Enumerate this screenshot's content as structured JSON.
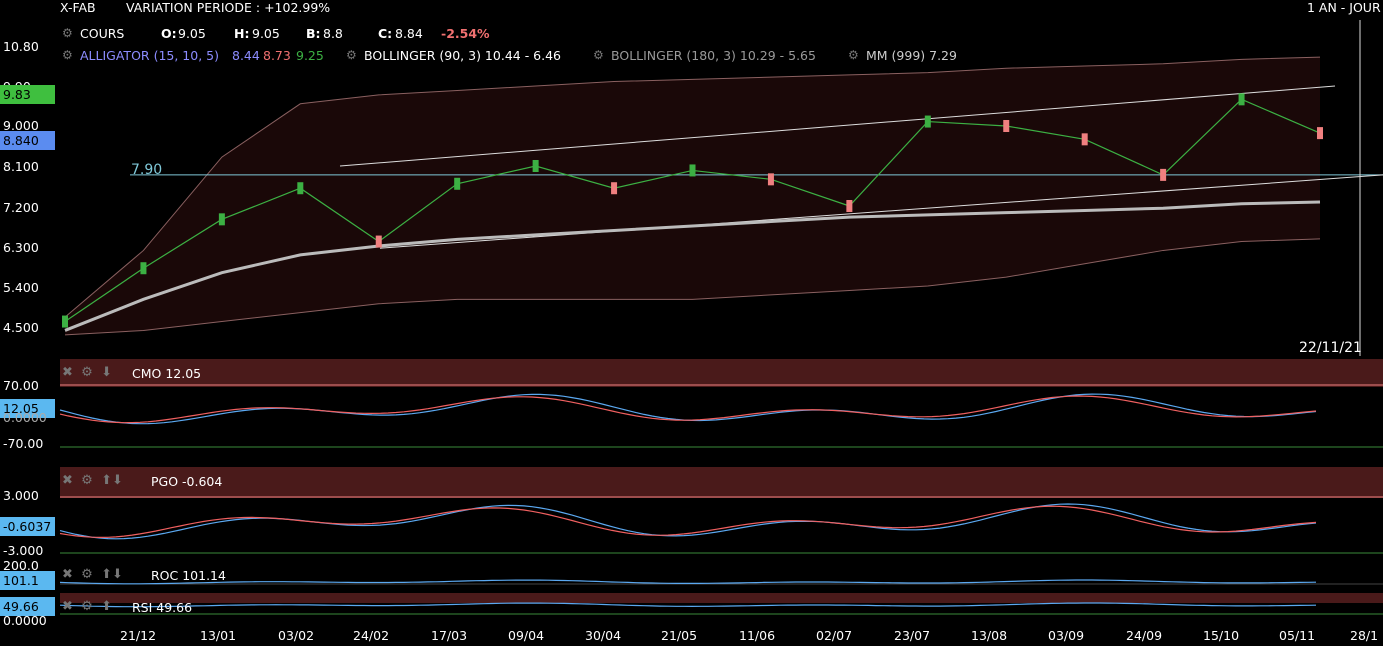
{
  "header": {
    "symbol": "X-FAB",
    "variation_label": "VARIATION PERIODE : +102.99%",
    "period": "1 AN - JOUR",
    "cours_label": "COURS",
    "open_label": "O:",
    "open_value": "9.05",
    "high_label": "H:",
    "high_value": "9.05",
    "low_label": "B:",
    "low_value": "8.8",
    "close_label": "C:",
    "close_value": "8.84",
    "change": "-2.54%",
    "alligator_label": "ALLIGATOR (15, 10, 5)",
    "alligator_v1": "8.44",
    "alligator_v2": "8.73",
    "alligator_v3": "9.25",
    "bollinger1_label": "BOLLINGER (90, 3) 10.44 - 6.46",
    "bollinger2_label": "BOLLINGER (180, 3) 10.29 - 5.65",
    "mm_label": "MM (999) 7.29"
  },
  "main_chart": {
    "y_ticks": [
      "10.80",
      "9.90",
      "9.000",
      "8.100",
      "7.200",
      "6.300",
      "5.400",
      "4.500"
    ],
    "price_badges": [
      "9.83",
      "8.840"
    ],
    "hline_label": "7.90",
    "cursor_date": "22/11/21"
  },
  "indicators": {
    "cmo": {
      "label": "CMO 12.05",
      "badge": "12.05",
      "ticks": [
        "70.00",
        "0.0000",
        "-70.00"
      ]
    },
    "pgo": {
      "label": "PGO -0.604",
      "badge": "-0.6037",
      "ticks": [
        "3.000",
        "-3.000"
      ]
    },
    "roc": {
      "label": "ROC 101.14",
      "badge": "101.1",
      "ticks": [
        "200.0"
      ]
    },
    "rsi": {
      "label": "RSI 49.66",
      "badge": "49.66",
      "ticks": [
        "0.0000"
      ]
    }
  },
  "x_axis": [
    "21/12",
    "13/01",
    "03/02",
    "24/02",
    "17/03",
    "09/04",
    "30/04",
    "21/05",
    "11/06",
    "02/07",
    "23/07",
    "13/08",
    "03/09",
    "24/09",
    "15/10",
    "05/11",
    "28/1"
  ],
  "colors": {
    "up": "#3cb043",
    "down": "#f08080",
    "badge_green": "#3fbf3f",
    "badge_blue": "#5b8cf0",
    "cyan": "#7fc8d8",
    "indicator_badge": "#5bb8f0"
  },
  "chart_data": {
    "type": "line",
    "title": "X-FAB",
    "x": [
      "21/12",
      "13/01",
      "03/02",
      "24/02",
      "17/03",
      "09/04",
      "30/04",
      "21/05",
      "11/06",
      "02/07",
      "23/07",
      "13/08",
      "03/09",
      "24/09",
      "15/10",
      "05/11",
      "22/11"
    ],
    "series": [
      {
        "name": "COURS",
        "values": [
          4.6,
          5.8,
          6.9,
          7.6,
          6.4,
          7.7,
          8.1,
          7.6,
          8.0,
          7.8,
          7.2,
          9.1,
          9.0,
          8.7,
          7.9,
          9.6,
          8.84
        ]
      },
      {
        "name": "MM (999)",
        "values": [
          4.4,
          5.1,
          5.7,
          6.1,
          6.3,
          6.45,
          6.55,
          6.65,
          6.75,
          6.85,
          6.95,
          7.0,
          7.05,
          7.1,
          7.15,
          7.25,
          7.29
        ]
      }
    ],
    "ylim": [
      4.2,
      10.9
    ],
    "hline": 7.9
  }
}
